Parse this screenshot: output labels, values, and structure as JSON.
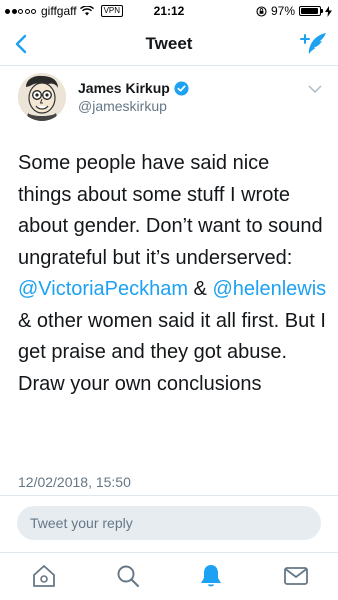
{
  "status_bar": {
    "carrier": "giffgaff",
    "vpn": "VPN",
    "time": "21:12",
    "battery": "97%",
    "battery_level": 0.97
  },
  "nav": {
    "title": "Tweet",
    "back_icon": "chevron-left-icon",
    "compose_icon": "compose-tweet-icon"
  },
  "tweet": {
    "author_name": "James Kirkup",
    "author_handle": "@jameskirkup",
    "verified": true,
    "text_intro": "Some people have said nice things about some stuff I wrote about gender. Don’t want to sound ungrateful but it’s underserved: ",
    "mention_1": "@VictoriaPeckham",
    "text_between": " & ",
    "mention_2": "@helenlewis",
    "text_outro": " & other women said it all first. But I get praise and they got abuse.  Draw your own conclusions",
    "timestamp": "12/02/2018, 15:50"
  },
  "reply": {
    "placeholder": "Tweet your reply"
  },
  "tabs": [
    {
      "icon": "home-icon"
    },
    {
      "icon": "search-icon"
    },
    {
      "icon": "notifications-icon"
    },
    {
      "icon": "messages-icon"
    }
  ],
  "colors": {
    "accent": "#1da1f2",
    "secondary_text": "#657786",
    "divider": "#e1e8ed",
    "reply_bg": "#e6ecf0"
  }
}
